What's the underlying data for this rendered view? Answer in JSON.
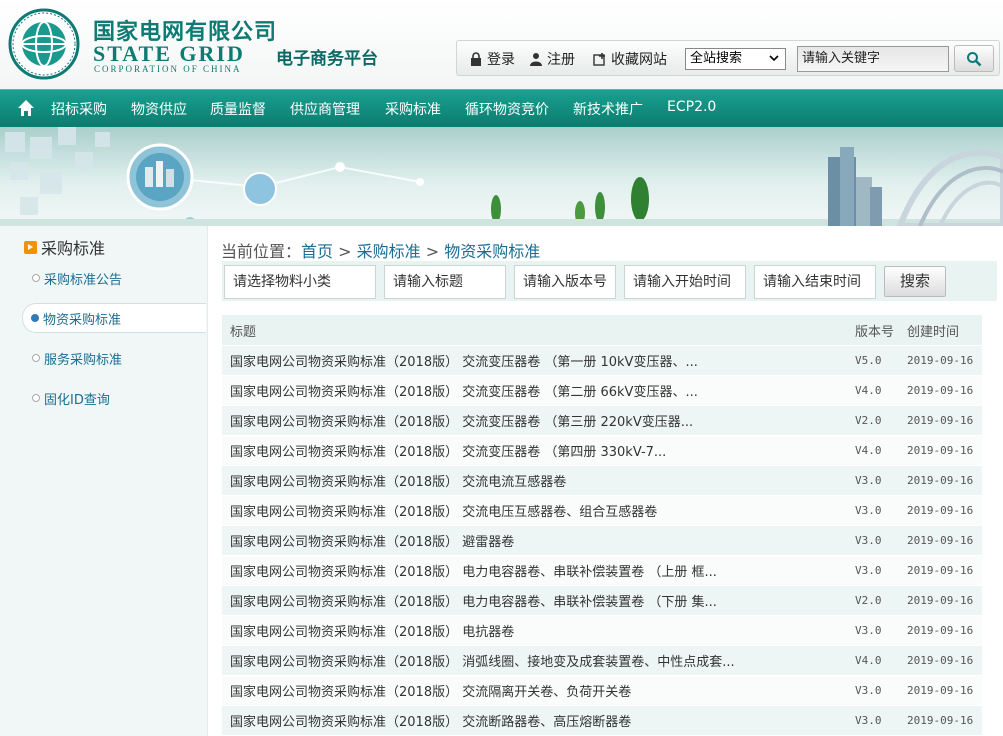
{
  "brand": {
    "name_cn": "国家电网有限公司",
    "name_en": "STATE GRID",
    "name_en_sub": "CORPORATION OF CHINA",
    "platform": "电子商务平台",
    "emblem_text": "国家电网公司 STATE GRID CORPORATION OF CHINA"
  },
  "topbar": {
    "login": "登录",
    "register": "注册",
    "favorite": "收藏网站",
    "scope_select": "全站搜索",
    "search_placeholder": "请输入关键字"
  },
  "nav": {
    "items": [
      "招标采购",
      "物资供应",
      "质量监督",
      "供应商管理",
      "采购标准",
      "循环物资竞价",
      "新技术推广",
      "ECP2.0"
    ]
  },
  "sidebar": {
    "title": "采购标准",
    "items": [
      {
        "label": "采购标准公告",
        "active": false
      },
      {
        "label": "物资采购标准",
        "active": true
      },
      {
        "label": "服务采购标准",
        "active": false
      },
      {
        "label": "固化ID查询",
        "active": false
      }
    ]
  },
  "breadcrumb": {
    "prefix": "当前位置：",
    "home": "首页",
    "sep": ">",
    "level1": "采购标准",
    "level2": "物资采购标准"
  },
  "filters": {
    "category": "请选择物料小类",
    "title": "请输入标题",
    "version": "请输入版本号",
    "start": "请输入开始时间",
    "end": "请输入结束时间",
    "search_button": "搜索"
  },
  "table": {
    "headers": {
      "title": "标题",
      "version": "版本号",
      "created": "创建时间"
    },
    "rows": [
      {
        "title": "国家电网公司物资采购标准（2018版） 交流变压器卷 （第一册 10kV变压器、...",
        "version": "V5.0",
        "created": "2019-09-16"
      },
      {
        "title": "国家电网公司物资采购标准（2018版） 交流变压器卷 （第二册 66kV变压器、...",
        "version": "V4.0",
        "created": "2019-09-16"
      },
      {
        "title": "国家电网公司物资采购标准（2018版） 交流变压器卷 （第三册 220kV变压器...",
        "version": "V2.0",
        "created": "2019-09-16"
      },
      {
        "title": "国家电网公司物资采购标准（2018版） 交流变压器卷 （第四册 330kV-7...",
        "version": "V4.0",
        "created": "2019-09-16"
      },
      {
        "title": "国家电网公司物资采购标准（2018版） 交流电流互感器卷",
        "version": "V3.0",
        "created": "2019-09-16"
      },
      {
        "title": "国家电网公司物资采购标准（2018版） 交流电压互感器卷、组合互感器卷",
        "version": "V3.0",
        "created": "2019-09-16"
      },
      {
        "title": "国家电网公司物资采购标准（2018版） 避雷器卷",
        "version": "V3.0",
        "created": "2019-09-16"
      },
      {
        "title": "国家电网公司物资采购标准（2018版） 电力电容器卷、串联补偿装置卷 （上册 框...",
        "version": "V3.0",
        "created": "2019-09-16"
      },
      {
        "title": "国家电网公司物资采购标准（2018版） 电力电容器卷、串联补偿装置卷 （下册 集...",
        "version": "V2.0",
        "created": "2019-09-16"
      },
      {
        "title": "国家电网公司物资采购标准（2018版） 电抗器卷",
        "version": "V3.0",
        "created": "2019-09-16"
      },
      {
        "title": "国家电网公司物资采购标准（2018版） 消弧线圈、接地变及成套装置卷、中性点成套...",
        "version": "V4.0",
        "created": "2019-09-16"
      },
      {
        "title": "国家电网公司物资采购标准（2018版） 交流隔离开关卷、负荷开关卷",
        "version": "V3.0",
        "created": "2019-09-16"
      },
      {
        "title": "国家电网公司物资采购标准（2018版） 交流断路器卷、高压熔断器卷",
        "version": "V3.0",
        "created": "2019-09-16"
      }
    ]
  },
  "colors": {
    "brand_teal": "#0e7a74",
    "nav_bg": "#0b7c6f",
    "link_blue": "#1a6d94",
    "accent_orange": "#f39200"
  }
}
